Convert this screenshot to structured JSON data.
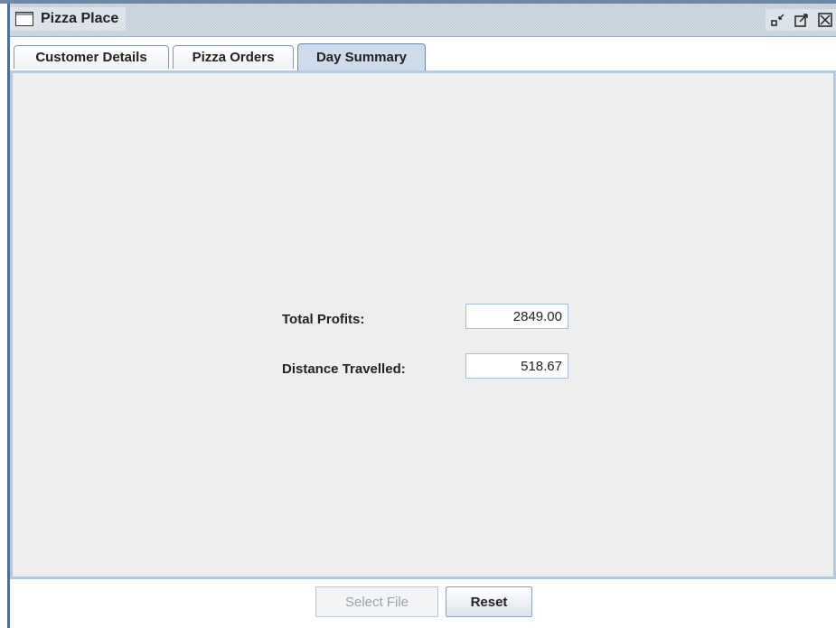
{
  "window": {
    "title": "Pizza Place",
    "controls": [
      "minimize-icon",
      "maximize-icon",
      "close-icon"
    ]
  },
  "tabs": [
    {
      "label": "Customer Details",
      "selected": false
    },
    {
      "label": "Pizza Orders",
      "selected": false
    },
    {
      "label": "Day Summary",
      "selected": true
    }
  ],
  "summary": {
    "total_profits_label": "Total Profits:",
    "total_profits_value": "2849.00",
    "distance_label": "Distance Travelled:",
    "distance_value": "518.67"
  },
  "buttons": {
    "select_file": "Select File",
    "reset": "Reset"
  },
  "colors": {
    "window_border": "#4f6f99",
    "selected_tab": "#cddbeb",
    "panel_background": "#eeeeee"
  }
}
